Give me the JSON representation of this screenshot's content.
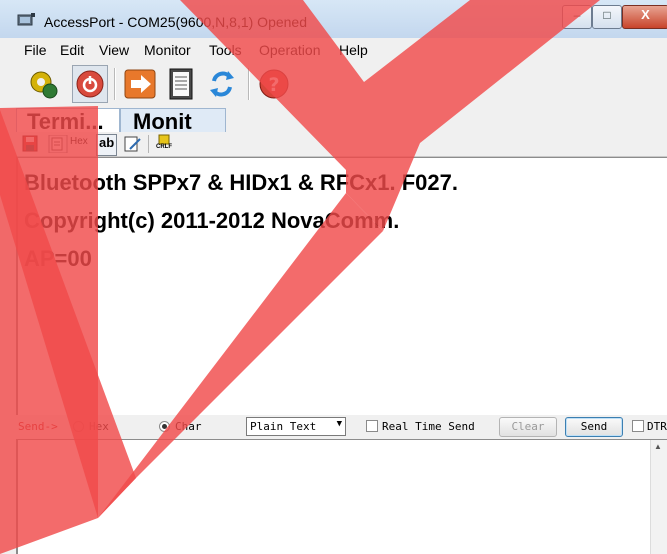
{
  "window": {
    "title": "AccessPort - COM25(9600,N,8,1) Opened",
    "controls": [
      "minimize",
      "maximize",
      "close"
    ],
    "close_glyph": "X"
  },
  "menu": [
    "File",
    "Edit",
    "View",
    "Monitor",
    "Tools",
    "Operation",
    "Help"
  ],
  "toolbar": {
    "buttons": [
      {
        "icon": "gear-connect-icon"
      },
      {
        "icon": "power-icon",
        "pressed": true
      },
      {
        "icon": "arrow-right-icon"
      },
      {
        "icon": "notepad-icon"
      },
      {
        "icon": "refresh-icon"
      },
      {
        "icon": "help-icon"
      }
    ]
  },
  "tabs": [
    {
      "label": "Termi...",
      "active": true
    },
    {
      "label": "Monit",
      "active": false
    }
  ],
  "subtoolbar": {
    "hex_label": "Hex",
    "ab_label": "ab",
    "crlf_label": "CRLF"
  },
  "terminal": {
    "lines": [
      {
        "text": "Bluetooth SPPx7 & HIDx1 & RFCx1. F027."
      },
      {
        "text": "Copyright(c) 2011-2012 NovaComm."
      },
      {
        "text": "AP=00"
      }
    ]
  },
  "sendbar": {
    "send_label": "Send->",
    "hex_option": "Hex",
    "char_option": "Char",
    "selected_mode": "Char",
    "format_value": "Plain Text",
    "realtime_label": "Real Time Send",
    "clear_label": "Clear",
    "send_button": "Send",
    "dtr_label": "DTR"
  },
  "colors": {
    "overlay_red": "#f04a4a",
    "title_bar": "#c9dcf0"
  }
}
